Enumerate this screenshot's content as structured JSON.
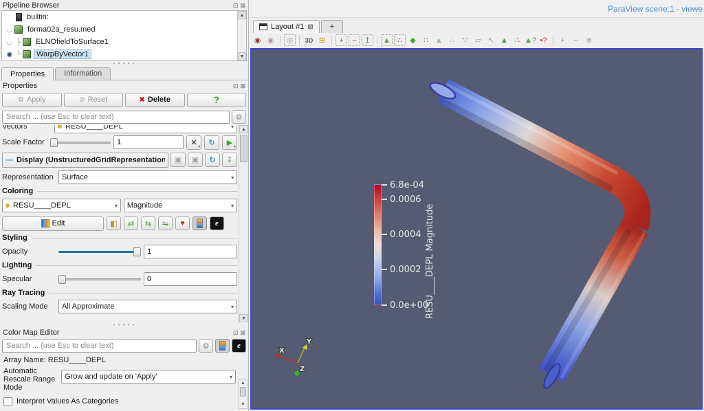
{
  "pipeline_browser": {
    "title": "Pipeline Browser",
    "items": [
      {
        "label": "builtin:"
      },
      {
        "label": "forma02a_resu.med"
      },
      {
        "label": "ELNOfieldToSurface1",
        "branch": "├"
      },
      {
        "label": "WarpByVector1",
        "branch": "└"
      }
    ]
  },
  "panel_tabs": {
    "properties": "Properties",
    "information": "Information"
  },
  "properties": {
    "title": "Properties",
    "apply": "Apply",
    "reset": "Reset",
    "delete": "Delete",
    "help": "?",
    "search_placeholder": "Search ... (use Esc to clear text)",
    "vectors_label": "Vectors",
    "vectors_value": "RESU____DEPL",
    "scale_factor_label": "Scale Factor",
    "scale_factor_value": "1",
    "display_header": "Display (UnstructuredGridRepresentation)",
    "representation_label": "Representation",
    "representation_value": "Surface",
    "coloring_header": "Coloring",
    "coloring_array": "RESU____DEPL",
    "coloring_component": "Magnitude",
    "edit_label": "Edit",
    "styling_header": "Styling",
    "opacity_label": "Opacity",
    "opacity_value": "1",
    "lighting_header": "Lighting",
    "specular_label": "Specular",
    "specular_value": "0",
    "ray_tracing_header": "Ray Tracing",
    "scaling_mode_label": "Scaling Mode",
    "scaling_mode_value": "All Approximate"
  },
  "color_map_editor": {
    "title": "Color Map Editor",
    "search_placeholder": "Search ... (use Esc to clear text)",
    "array_name": "Array Name: RESU____DEPL",
    "rescale_label": "Automatic Rescale Range Mode",
    "rescale_value": "Grow and update on 'Apply'",
    "interpret_label": "Interpret Values As Categories"
  },
  "viewport": {
    "window_title": "ParaView scene:1 - viewe",
    "layout_tab_label": "Layout #1",
    "new_tab_label": "+",
    "background_color": "#555b72",
    "active_border_color": "#4047d0",
    "legend": {
      "title": "RESU____DEPL Magnitude",
      "ticks": [
        {
          "label": "6.8e-04"
        },
        {
          "label": "0.0006"
        },
        {
          "label": "0.0004"
        },
        {
          "label": "0.0002"
        },
        {
          "label": "0.0e+00"
        }
      ],
      "top_color": "#b40426",
      "bottom_color": "#3d52c5"
    },
    "axes": {
      "x": "X",
      "y": "Y",
      "z": "Z"
    },
    "toolbar": [
      {
        "name": "reset-camera",
        "glyph": "◉"
      },
      {
        "name": "reset-camera-closest",
        "glyph": "◉"
      },
      {
        "name": "zoom-to-data",
        "glyph": "◎"
      },
      {
        "name": "toggle-2d3d",
        "glyph": "3D"
      },
      {
        "name": "zoom-to-box",
        "glyph": "⊞"
      },
      {
        "name": "selection-add",
        "glyph": "+"
      },
      {
        "name": "selection-subtract",
        "glyph": "−"
      },
      {
        "name": "selection-toggle",
        "glyph": "↥"
      },
      {
        "name": "select-cells-on",
        "glyph": "▲"
      },
      {
        "name": "select-points-on",
        "glyph": "∴"
      },
      {
        "name": "select-cells-through",
        "glyph": "◆"
      },
      {
        "name": "select-points-through",
        "glyph": "∷"
      },
      {
        "name": "interactive-select-cells",
        "glyph": "▲"
      },
      {
        "name": "interactive-select-points",
        "glyph": "∴"
      },
      {
        "name": "hover-points",
        "glyph": "∵"
      },
      {
        "name": "select-block",
        "glyph": "▱"
      },
      {
        "name": "pick-point",
        "glyph": "↖"
      },
      {
        "name": "query-select-cells",
        "glyph": "▲"
      },
      {
        "name": "query-select-points",
        "glyph": "∴"
      },
      {
        "name": "select-cells-query",
        "glyph": "▲?"
      },
      {
        "name": "select-points-query",
        "glyph": "•?"
      },
      {
        "name": "grow-selection",
        "glyph": "+"
      },
      {
        "name": "shrink-selection",
        "glyph": "−"
      },
      {
        "name": "clear-selection",
        "glyph": "⊗"
      }
    ]
  },
  "icons": {
    "float": "⊡",
    "close": "⊠",
    "gear": "⚙",
    "apply_gear": "⚙",
    "reset_slash": "⊘",
    "delete_x": "✖",
    "combo_arrow": "▾",
    "clear_x": "✕",
    "refresh": "↻",
    "play": "▶",
    "copy": "▣",
    "paste": "▣",
    "export": "↧",
    "collapse": "—",
    "solid_color": "◧",
    "rescale_range": "⇄",
    "rescale_time": "⇆",
    "rescale_custom": "⇋",
    "preset_heart": "♥",
    "edit_colormap": "e",
    "eye_visible": "◉",
    "eye_hidden": "◡",
    "scroll_up": "▲",
    "scroll_down": "▼",
    "splitter_dots": "• • • • •",
    "tab_close": "⊠"
  }
}
